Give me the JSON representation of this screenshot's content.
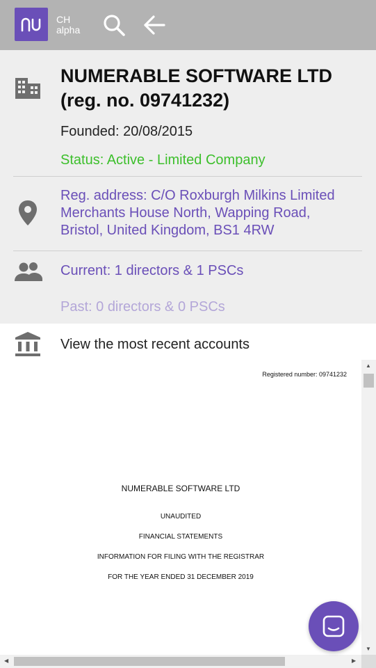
{
  "app": {
    "logo_text": "nu",
    "brand_line1": "CH",
    "brand_line2": "alpha"
  },
  "icons": {
    "search": "search-icon",
    "back": "arrow-left-icon",
    "company": "building-icon",
    "address": "location-pin-icon",
    "people": "people-icon",
    "accounts": "bank-icon",
    "chat": "chat-icon"
  },
  "company": {
    "name": "NUMERABLE SOFTWARE LTD",
    "reg": "(reg. no. 09741232)",
    "founded": "Founded: 20/08/2015",
    "status": "Status: Active - Limited Company"
  },
  "address": {
    "line1": "Reg. address: C/O Roxburgh Milkins Limited",
    "line2": "Merchants House North, Wapping Road,",
    "line3": "Bristol, United Kingdom, BS1 4RW"
  },
  "people": {
    "current": "Current: 1 directors & 1 PSCs",
    "past": "Past: 0 directors & 0 PSCs"
  },
  "accounts": {
    "label": "View the most recent accounts"
  },
  "document": {
    "registered_number": "Registered number:  09741232",
    "company": "NUMERABLE SOFTWARE LTD",
    "line1": "UNAUDITED",
    "line2": "FINANCIAL STATEMENTS",
    "line3": "INFORMATION FOR FILING WITH THE REGISTRAR",
    "line4": "FOR THE YEAR ENDED 31 DECEMBER 2019"
  },
  "colors": {
    "accent": "#6a4fb8",
    "status_green": "#3cbf2b",
    "topbar": "#b3b3b3",
    "panel": "#eeeeee"
  }
}
